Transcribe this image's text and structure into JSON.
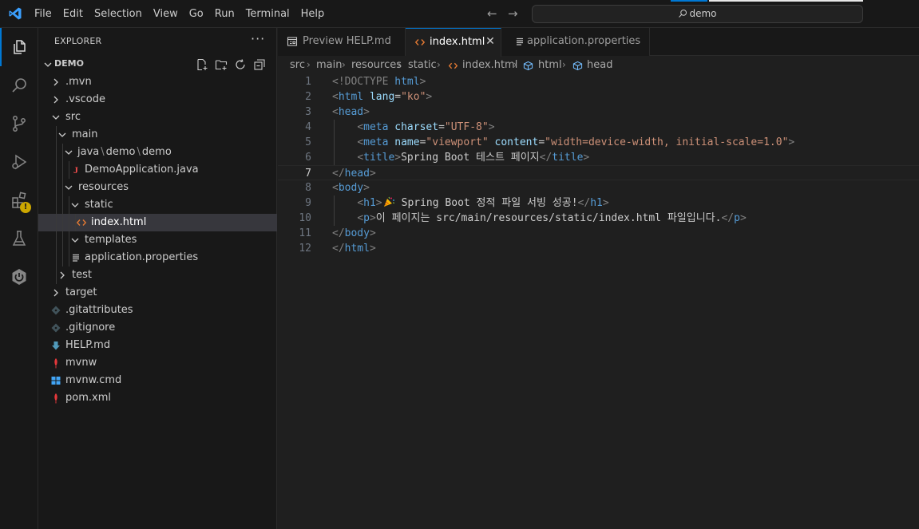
{
  "titlebar": {
    "menu": [
      "File",
      "Edit",
      "Selection",
      "View",
      "Go",
      "Run",
      "Terminal",
      "Help"
    ],
    "search_text": "demo",
    "back_icon": "arrow-left-icon",
    "forward_icon": "arrow-right-icon"
  },
  "activity_bar": {
    "items": [
      "explorer",
      "search",
      "source-control",
      "run-and-debug",
      "extensions",
      "testing",
      "spring-boot-dashboard"
    ],
    "extensions_badge": "!"
  },
  "sidebar": {
    "header": "EXPLORER",
    "more": "···",
    "folder_name": "DEMO",
    "tree": [
      {
        "label": "src",
        "level": 1
      },
      {
        "label": "main",
        "level": 2
      },
      {
        "label": "resources",
        "level": 3
      },
      {
        "label": "static",
        "level": 4
      },
      {
        "label": "index.html",
        "level": 5
      },
      {
        "label": "templates",
        "level": 4
      },
      {
        "label": "application.properties",
        "level": 4
      },
      {
        "label": "test",
        "level": 2
      },
      {
        "label": "target",
        "level": 1
      }
    ],
    "items": {
      "mvn": ".mvn",
      "vscode": ".vscode",
      "src": "src",
      "main": "main",
      "java_path": [
        "java",
        "demo",
        "demo"
      ],
      "demo_application": "DemoApplication.java",
      "resources": "resources",
      "static": "static",
      "index_html": "index.html",
      "templates": "templates",
      "application_properties": "application.properties",
      "test": "test",
      "target": "target",
      "gitattributes": ".gitattributes",
      "gitignore": ".gitignore",
      "help_md": "HELP.md",
      "mvnw": "mvnw",
      "mvnw_cmd": "mvnw.cmd",
      "pom_xml": "pom.xml"
    }
  },
  "editor": {
    "tabs": [
      {
        "label": "Preview HELP.md",
        "active": false
      },
      {
        "label": "index.html",
        "active": true
      },
      {
        "label": "application.properties",
        "active": false
      }
    ],
    "close_glyph": "✕",
    "breadcrumb": [
      "src",
      "main",
      "resources",
      "static",
      "index.html",
      "html",
      "head"
    ],
    "current_line": 7,
    "line_numbers": [
      "1",
      "2",
      "3",
      "4",
      "5",
      "6",
      "7",
      "8",
      "9",
      "10",
      "11",
      "12"
    ],
    "code": {
      "l1": {
        "open": "<!DOCTYPE",
        "kw": " html",
        "close": ">"
      },
      "l2": {
        "tag": "html",
        "attr": "lang",
        "eq": "=",
        "val": "\"ko\""
      },
      "l3": {
        "tag": "head"
      },
      "l4": {
        "tag": "meta",
        "attr": "charset",
        "val": "\"UTF-8\""
      },
      "l5": {
        "tag": "meta",
        "attr1": "name",
        "val1": "\"viewport\"",
        "attr2": "content",
        "val2": "\"width=device-width, initial-scale=1.0\""
      },
      "l6": {
        "tag": "title",
        "text": "Spring Boot 테스트 페이지"
      },
      "l7": {
        "tag": "head"
      },
      "l8": {
        "tag": "body"
      },
      "l9": {
        "tag": "h1",
        "text": "Spring Boot 정적 파일 서빙 성공!",
        "emoji": "party-popper-icon"
      },
      "l10": {
        "tag": "p",
        "text": "이 페이지는 src/main/resources/static/index.html 파일입니다."
      },
      "l11": {
        "tag": "body"
      },
      "l12": {
        "tag": "html"
      }
    }
  },
  "colors": {
    "accent": "#0078d4",
    "tag": "#569cd6",
    "attribute": "#9cdcfe",
    "string": "#ce9178",
    "punctuation": "#808080",
    "java_icon": "#f14c4c",
    "html_icon": "#e37933",
    "markdown_icon": "#519aba",
    "maven_icon": "#e5383b",
    "windows_icon": "#42a5f5"
  }
}
